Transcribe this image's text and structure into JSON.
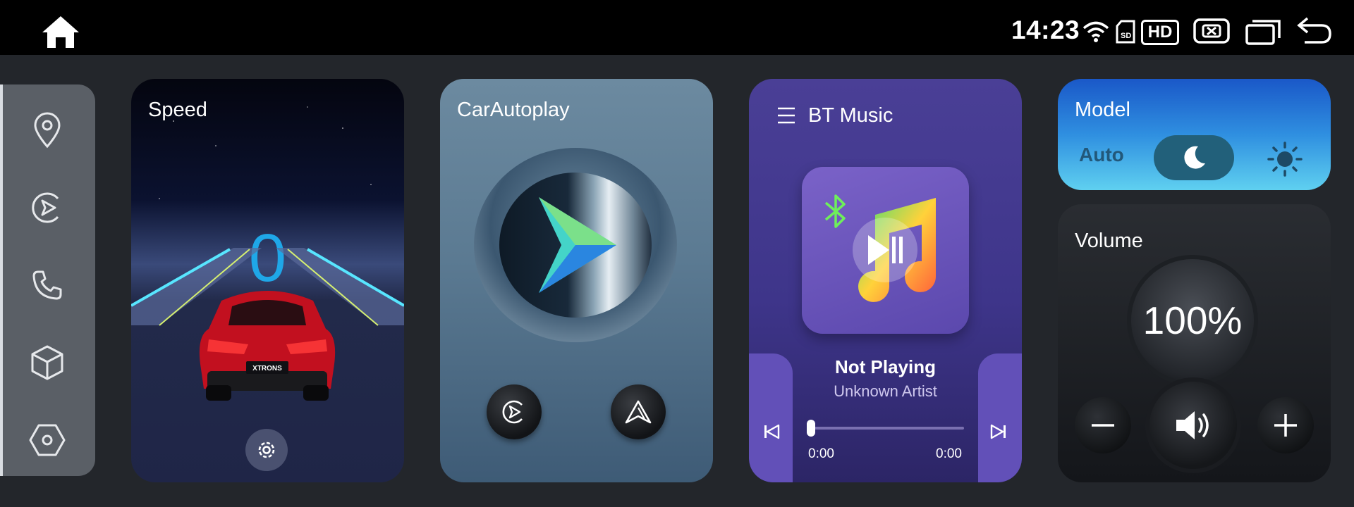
{
  "statusbar": {
    "clock": "14:23",
    "hd_label": "HD",
    "icons": [
      "home-icon",
      "wifi-icon",
      "sd-card-icon",
      "hd-icon",
      "close-box-icon",
      "recent-apps-icon",
      "back-icon"
    ]
  },
  "sidebar": {
    "items": [
      {
        "icon": "location-pin-icon"
      },
      {
        "icon": "carplay-icon"
      },
      {
        "icon": "phone-icon"
      },
      {
        "icon": "cube-icon"
      },
      {
        "icon": "hexagon-settings-icon"
      }
    ]
  },
  "speed": {
    "title": "Speed",
    "value": "0",
    "brand_plate": "XTRONS"
  },
  "carautoplay": {
    "title": "CarAutoplay"
  },
  "bt_music": {
    "title": "BT Music",
    "track": "Not Playing",
    "artist": "Unknown Artist",
    "current_time": "0:00",
    "total_time": "0:00",
    "progress": 0
  },
  "model": {
    "title": "Model",
    "auto_label": "Auto",
    "mode": "night"
  },
  "volume": {
    "title": "Volume",
    "value": "100%"
  },
  "colors": {
    "speed_value": "#1fa7e8",
    "bt_card": "#4a3f96",
    "model_card": "#2f8fe0"
  }
}
